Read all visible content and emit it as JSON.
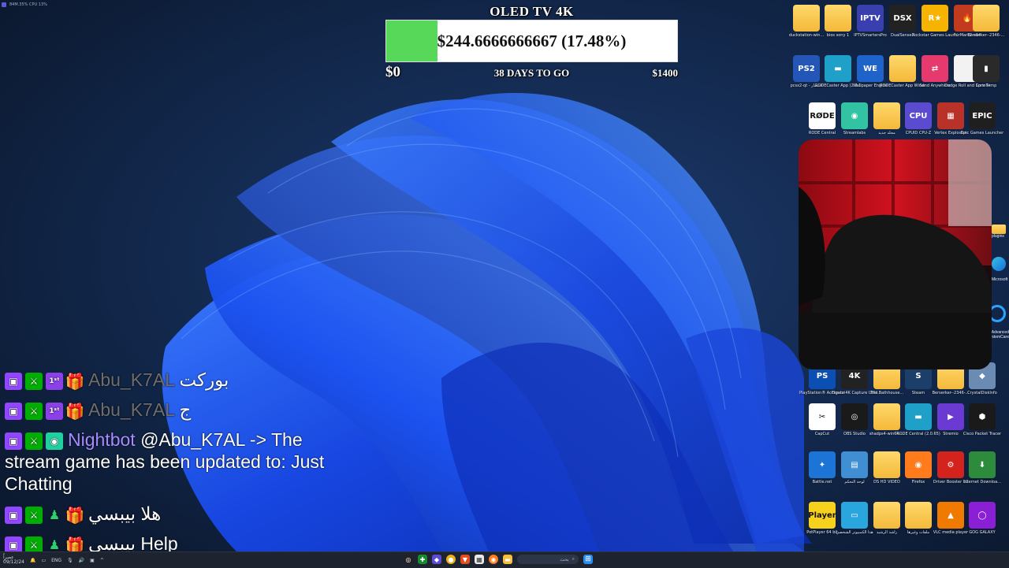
{
  "perf": {
    "text": "84M.35%   CPU 13%"
  },
  "goal": {
    "title": "OLED TV 4K",
    "amount": "$244.6666666667 (17.48%)",
    "progress_percent": 17.48,
    "start": "$0",
    "days_left": "38 DAYS TO GO",
    "end": "$1400"
  },
  "desktop_icons": [
    {
      "label": "duckstation-win...",
      "kind": "folder"
    },
    {
      "label": "bios sony 1",
      "kind": "folder"
    },
    {
      "label": "IPTVSmartersPro",
      "kind": "app",
      "text": "IPTV",
      "color": "#3a3fb0"
    },
    {
      "label": "DualSenseX",
      "kind": "app",
      "text": "DSX",
      "color": "#222"
    },
    {
      "label": "Rockstar Games Launcher",
      "kind": "app",
      "text": "R★",
      "color": "#f6b400"
    },
    {
      "label": "FurMark2 x64",
      "kind": "app",
      "text": "🔥",
      "color": "#c23b1e"
    },
    {
      "label": "Berserker--2346-...",
      "kind": "folder"
    },
    {
      "label": "pcsx2-qt - اختصار",
      "kind": "app",
      "text": "PS2",
      "color": "#2456b8"
    },
    {
      "label": "RODECaster App (2.0.102)",
      "kind": "app",
      "text": "▬",
      "color": "#1fa0c8"
    },
    {
      "label": "Wallpaper Engine",
      "kind": "app",
      "text": "WE",
      "color": "#1d63c9"
    },
    {
      "label": "RODECaster App Windows v2.0.105",
      "kind": "folder"
    },
    {
      "label": "Send Anywhere",
      "kind": "app",
      "text": "⇄",
      "color": "#e63a6e"
    },
    {
      "label": "Dodge Roll and Sprint-496-2-30...",
      "kind": "app",
      "text": "",
      "color": "#f2f2f2"
    },
    {
      "label": "Core Temp",
      "kind": "app",
      "text": "▮",
      "color": "#2a2a2a"
    },
    {
      "label": "RODE Central",
      "kind": "app",
      "text": "RØDE",
      "color": "#ffffff"
    },
    {
      "label": "Streamlabs",
      "kind": "app",
      "text": "◉",
      "color": "#31c3a2"
    },
    {
      "label": "مجلد جديد",
      "kind": "folder"
    },
    {
      "label": "CPUID CPU-Z",
      "kind": "app",
      "text": "CPU",
      "color": "#5a4bd1"
    },
    {
      "label": "Vertex Explosion",
      "kind": "app",
      "text": "▦",
      "color": "#b8322a"
    },
    {
      "label": "Epic Games Launcher",
      "kind": "app",
      "text": "EPIC",
      "color": "#1f1f1f"
    },
    {
      "label": "PlayStation® Accessories",
      "kind": "app",
      "text": "PS",
      "color": "#0b4fb3"
    },
    {
      "label": "Elgato 4K Capture Utility",
      "kind": "app",
      "text": "4K",
      "color": "#222"
    },
    {
      "label": "The.Bathhouse...",
      "kind": "folder"
    },
    {
      "label": "Steam",
      "kind": "app",
      "text": "S",
      "color": "#1b3f68"
    },
    {
      "label": "Berserker--2346-...",
      "kind": "folder"
    },
    {
      "label": "CrystalDiskInfo",
      "kind": "app",
      "text": "◆",
      "color": "#6c8bb2"
    },
    {
      "label": "CapCut",
      "kind": "app",
      "text": "✂",
      "color": "#ffffff"
    },
    {
      "label": "OBS Studio",
      "kind": "app",
      "text": "◎",
      "color": "#1a1a1a"
    },
    {
      "label": "shadps4-win64-...",
      "kind": "folder"
    },
    {
      "label": "RODE Central (2.0.65)",
      "kind": "app",
      "text": "▬",
      "color": "#1fa0c8"
    },
    {
      "label": "Stremio",
      "kind": "app",
      "text": "▶",
      "color": "#6b3ad3"
    },
    {
      "label": "Cisco Packet Tracer",
      "kind": "app",
      "text": "⬢",
      "color": "#1a1a1a"
    },
    {
      "label": "Battle.net",
      "kind": "app",
      "text": "✦",
      "color": "#1c74d6"
    },
    {
      "label": "لوحة التحكم",
      "kind": "app",
      "text": "▤",
      "color": "#3f8fd2"
    },
    {
      "label": "DS HD VIDEO",
      "kind": "folder"
    },
    {
      "label": "Firefox",
      "kind": "app",
      "text": "◉",
      "color": "#ff7b1c"
    },
    {
      "label": "Driver Booster 12",
      "kind": "app",
      "text": "⚙",
      "color": "#d4231c"
    },
    {
      "label": "Internet Downloa...",
      "kind": "app",
      "text": "⬇",
      "color": "#2c8c3c"
    },
    {
      "label": "PotPlayer 64 bit",
      "kind": "app",
      "text": "Player",
      "color": "#f7d21c"
    },
    {
      "label": "هذا الكمبيوتر الشخصي",
      "kind": "app",
      "text": "▭",
      "color": "#29a6de"
    },
    {
      "label": "راشد الرشيد",
      "kind": "folder"
    },
    {
      "label": "ملفات وغيرها",
      "kind": "folder"
    },
    {
      "label": "VLC media player",
      "kind": "app",
      "text": "▲",
      "color": "#f07a00"
    },
    {
      "label": "GOG GALAXY",
      "kind": "app",
      "text": "◯",
      "color": "#8a1fd6"
    }
  ],
  "side_partial_labels": [
    "plugins",
    "Microsoft Edge",
    "Advanced SystemCare"
  ],
  "chat": {
    "messages": [
      {
        "badges": [
          "twitch",
          "mod",
          "sub",
          "gift"
        ],
        "user": "Abu_K7AL",
        "user_color": "grey",
        "text": "بوركت"
      },
      {
        "badges": [
          "twitch",
          "mod",
          "sub",
          "gift"
        ],
        "user": "Abu_K7AL",
        "user_color": "grey",
        "text": "ج"
      },
      {
        "badges": [
          "twitch",
          "mod",
          "vip"
        ],
        "user": "Nightbot",
        "user_color": "night",
        "text": "@Abu_K7AL -> The stream game has been updated to: Just Chatting"
      },
      {
        "badges": [
          "twitch",
          "mod",
          "mini",
          "gift"
        ],
        "user": "",
        "user_color": "none",
        "text": "هلا بيبسي"
      },
      {
        "badges": [
          "twitch",
          "mod",
          "mini",
          "gift"
        ],
        "user": "",
        "user_color": "none",
        "text": "بيبسي Help"
      }
    ]
  },
  "taskbar": {
    "clock_line1": "عصراً",
    "clock_line2": "09/12/24",
    "lang": "ENG",
    "search_placeholder": "بحث"
  }
}
